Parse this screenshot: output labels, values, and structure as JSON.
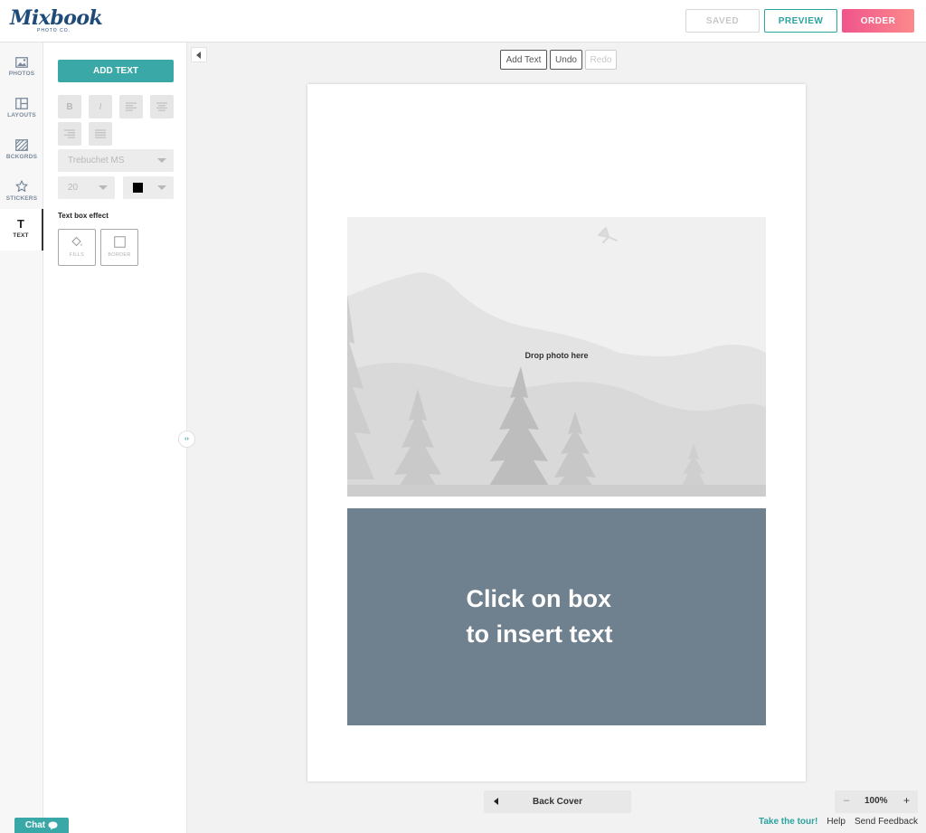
{
  "header": {
    "logo_text": "Mixbook",
    "logo_sub": "PHOTO CO.",
    "saved_label": "SAVED",
    "preview_label": "PREVIEW",
    "order_label": "ORDER"
  },
  "leftnav": {
    "items": [
      {
        "label": "PHOTOS",
        "icon": "image-icon"
      },
      {
        "label": "LAYOUTS",
        "icon": "layout-icon"
      },
      {
        "label": "BCKGRDS",
        "icon": "background-icon"
      },
      {
        "label": "STICKERS",
        "icon": "star-icon"
      },
      {
        "label": "TEXT",
        "icon": "text-icon",
        "glyph": "T",
        "active": true
      }
    ]
  },
  "panel": {
    "add_text_label": "ADD TEXT",
    "bold_label": "B",
    "italic_label": "I",
    "font_family": "Trebuchet MS",
    "font_size": "20",
    "text_color": "#000000",
    "effect_title": "Text box effect",
    "effects": [
      {
        "label": "FILLS",
        "icon": "paint-bucket-icon"
      },
      {
        "label": "BORDER",
        "icon": "border-icon"
      }
    ]
  },
  "toolbar": {
    "add_text": "Add Text",
    "undo": "Undo",
    "redo": "Redo"
  },
  "canvas": {
    "resize_glyph": "‹›",
    "drop_photo": "Drop photo here",
    "text_box_line1": "Click on box",
    "text_box_line2": "to insert text",
    "text_box_color": "#6f808f"
  },
  "page_nav": {
    "label": "Back Cover"
  },
  "zoom": {
    "minus": "–",
    "value": "100%",
    "plus": "+"
  },
  "footer": {
    "tour": "Take the tour!",
    "help": "Help",
    "feedback": "Send Feedback"
  },
  "chat": {
    "label": "Chat"
  },
  "colors": {
    "accent": "#3aa8a6",
    "order_start": "#f0548b",
    "order_end": "#fb8a8c"
  }
}
